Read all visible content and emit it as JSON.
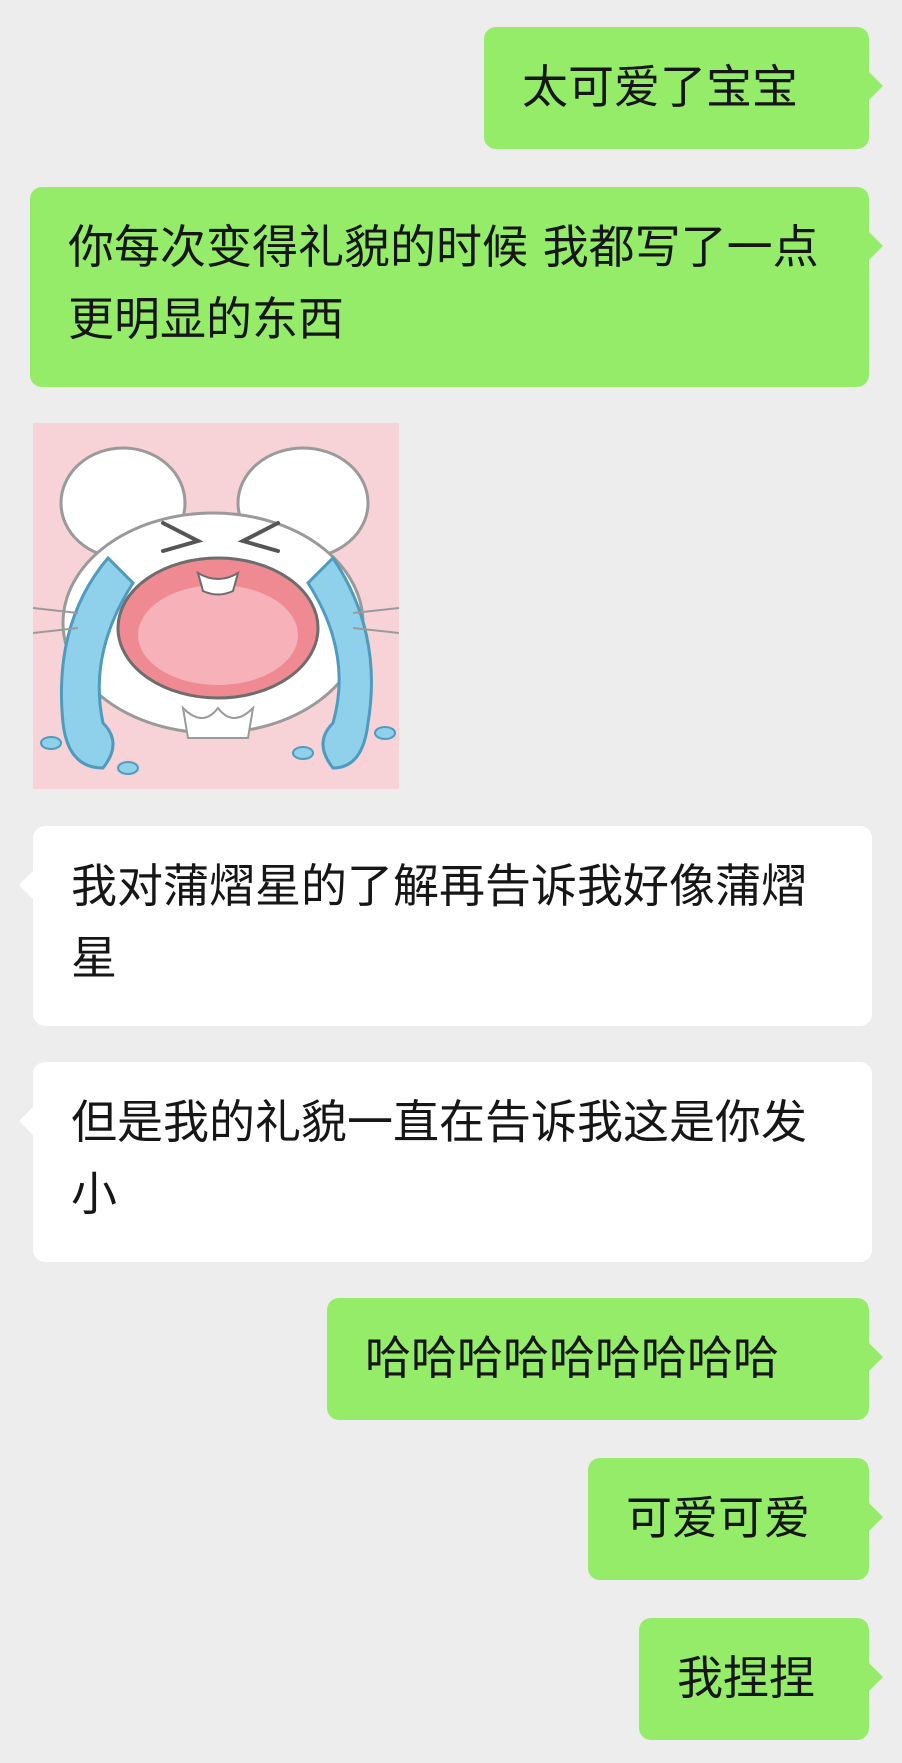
{
  "messages": [
    {
      "side": "sent",
      "text": "太可爱了宝宝"
    },
    {
      "side": "sent",
      "text": "你每次变得礼貌的时候 我都写了一点更明显的东西"
    },
    {
      "side": "recv",
      "type": "sticker",
      "sticker": "crying-mouse-sticker"
    },
    {
      "side": "recv",
      "text": "我对蒲熠星的了解再告诉我好像蒲熠星"
    },
    {
      "side": "recv",
      "text": "但是我的礼貌一直在告诉我这是你发小"
    },
    {
      "side": "sent",
      "text": "哈哈哈哈哈哈哈哈哈"
    },
    {
      "side": "sent",
      "text": "可爱可爱"
    },
    {
      "side": "sent",
      "text": "我捏捏"
    }
  ],
  "colors": {
    "background": "#ededed",
    "sent_bubble": "#95ec69",
    "received_bubble": "#ffffff",
    "text": "#161616"
  }
}
